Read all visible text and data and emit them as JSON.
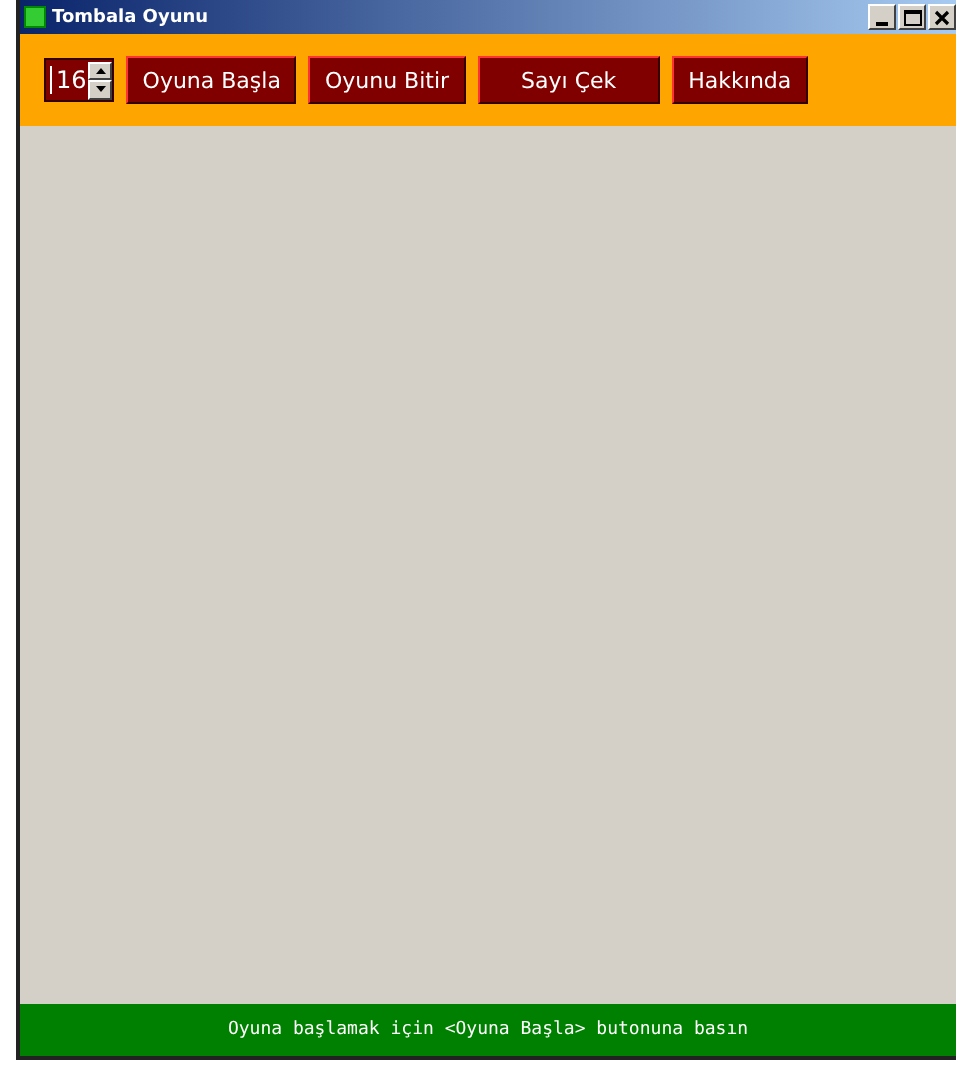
{
  "window": {
    "title": "Tombala Oyunu"
  },
  "toolbar": {
    "spinner": {
      "value": "16"
    },
    "buttons": [
      "Oyuna Başla",
      "Oyunu Bitir",
      "Sayı Çek",
      "Hakkında"
    ]
  },
  "status_bar": "Oyuna başlamak için <Oyuna Başla> butonuna basın"
}
